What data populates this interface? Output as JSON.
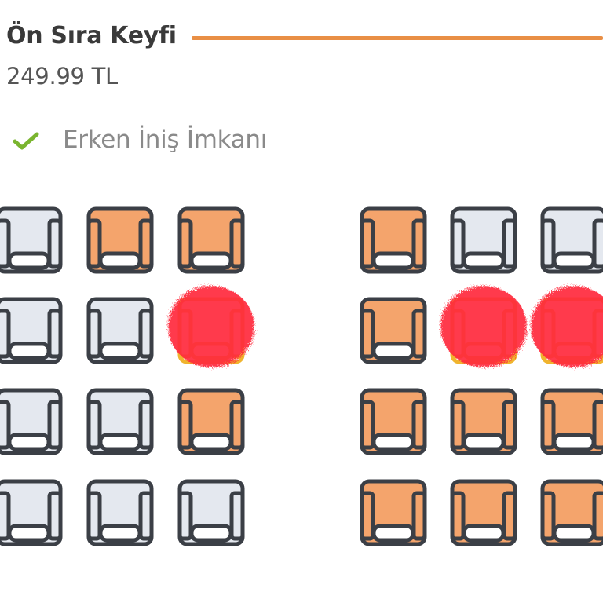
{
  "package": {
    "title": "Ön Sıra Keyfi",
    "price": "249.99 TL"
  },
  "features": [
    {
      "icon": "check-icon",
      "label": "Erken İniş İmkanı"
    }
  ],
  "colors": {
    "accent": "#e98f45",
    "seat_available": "#f4a46c",
    "seat_unavailable": "#e4e8ef",
    "seat_outline": "#3b3f46",
    "seat_selected_outline": "#f0b42e",
    "check": "#7ab52f",
    "scribble": "#ff2b3d"
  },
  "seat_map": {
    "left_block": [
      [
        "unavailable",
        "available",
        "available"
      ],
      [
        "unavailable",
        "unavailable",
        "selected"
      ],
      [
        "unavailable",
        "unavailable",
        "available"
      ],
      [
        "unavailable",
        "unavailable",
        "unavailable"
      ]
    ],
    "right_block": [
      [
        "available",
        "unavailable",
        "unavailable"
      ],
      [
        "available",
        "selected",
        "selected"
      ],
      [
        "available",
        "available",
        "available"
      ],
      [
        "available",
        "available",
        "available"
      ]
    ]
  }
}
